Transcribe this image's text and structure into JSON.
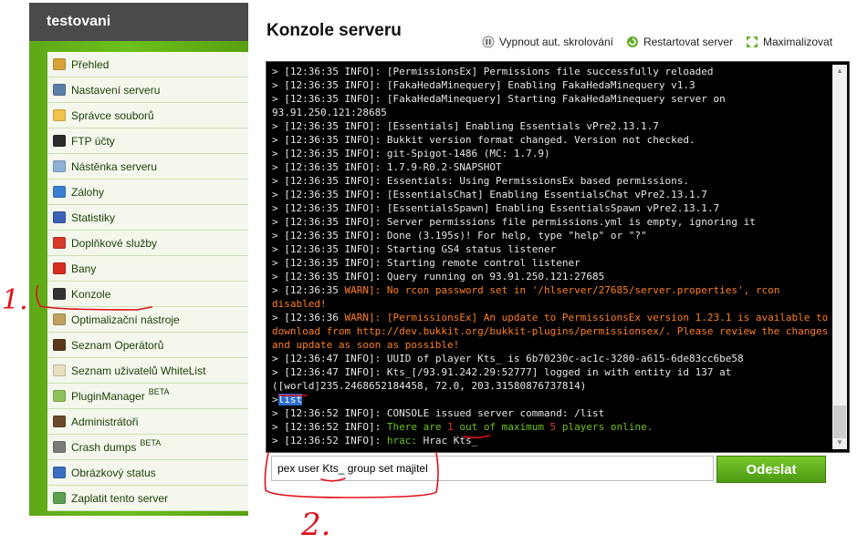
{
  "sidebar": {
    "brand": "testovani",
    "items": [
      {
        "label": "Přehled",
        "icon": "magnifier-icon",
        "color": "#d8a23a"
      },
      {
        "label": "Nastavení serveru",
        "icon": "wrench-icon",
        "color": "#5b7fa8"
      },
      {
        "label": "Správce souborů",
        "icon": "folder-icon",
        "color": "#f1c34a"
      },
      {
        "label": "FTP účty",
        "icon": "ftp-icon",
        "color": "#2a2a2a"
      },
      {
        "label": "Nástěnka serveru",
        "icon": "board-icon",
        "color": "#8fb0d6"
      },
      {
        "label": "Zálohy",
        "icon": "disc-icon",
        "color": "#3a7fd0"
      },
      {
        "label": "Statistiky",
        "icon": "chart-icon",
        "color": "#3c62b8"
      },
      {
        "label": "Doplňkové služby",
        "icon": "gift-icon",
        "color": "#d63b2a"
      },
      {
        "label": "Bany",
        "icon": "cross-icon",
        "color": "#d62d20"
      },
      {
        "label": "Konzole",
        "icon": "terminal-icon",
        "color": "#333333"
      },
      {
        "label": "Optimalizační nástroje",
        "icon": "wand-icon",
        "color": "#c0a060"
      },
      {
        "label": "Seznam Operátorů",
        "icon": "operator-icon",
        "color": "#5a3a1a"
      },
      {
        "label": "Seznam uživatelů WhiteList",
        "icon": "clipboard-icon",
        "color": "#e8e0c0"
      },
      {
        "label": "PluginManager",
        "icon": "puzzle-icon",
        "color": "#8fc25a",
        "badge": "BETA"
      },
      {
        "label": "Administrátoři",
        "icon": "admin-icon",
        "color": "#6b4a2a"
      },
      {
        "label": "Crash dumps",
        "icon": "gear-icon",
        "color": "#7a7a7a",
        "badge": "BETA"
      },
      {
        "label": "Obrázkový status",
        "icon": "image-icon",
        "color": "#3a6fc0"
      },
      {
        "label": "Zaplatit tento server",
        "icon": "money-icon",
        "color": "#5aa050"
      }
    ]
  },
  "main": {
    "title": "Konzole serveru",
    "toolbar": {
      "autoscroll": "Vypnout aut. skrolování",
      "restart": "Restartovat server",
      "maximize": "Maximalizovat"
    }
  },
  "console": {
    "lines": [
      {
        "type": "info",
        "prefix": "> [12:36:35 INFO]: ",
        "text": "[PermissionsEx] Permissions file successfully reloaded"
      },
      {
        "type": "info",
        "prefix": "> [12:36:35 INFO]: ",
        "text": "[FakaHedaMinequery] Enabling FakaHedaMinequery v1.3"
      },
      {
        "type": "info",
        "prefix": "> [12:36:35 INFO]: ",
        "text": "[FakaHedaMinequery] Starting FakaHedaMinequery server on 93.91.250.121:28685"
      },
      {
        "type": "info",
        "prefix": "> [12:36:35 INFO]: ",
        "text": "[Essentials] Enabling Essentials vPre2.13.1.7"
      },
      {
        "type": "info",
        "prefix": "> [12:36:35 INFO]: ",
        "text": "Bukkit version format changed. Version not checked."
      },
      {
        "type": "info",
        "prefix": "> [12:36:35 INFO]: ",
        "text": "git-Spigot-1486 (MC: 1.7.9)"
      },
      {
        "type": "info",
        "prefix": "> [12:36:35 INFO]: ",
        "text": "1.7.9-R0.2-SNAPSHOT"
      },
      {
        "type": "info",
        "prefix": "> [12:36:35 INFO]: ",
        "text": "Essentials: Using PermissionsEx based permissions."
      },
      {
        "type": "info",
        "prefix": "> [12:36:35 INFO]: ",
        "text": "[EssentialsChat] Enabling EssentialsChat vPre2.13.1.7"
      },
      {
        "type": "info",
        "prefix": "> [12:36:35 INFO]: ",
        "text": "[EssentialsSpawn] Enabling EssentialsSpawn vPre2.13.1.7"
      },
      {
        "type": "info",
        "prefix": "> [12:36:35 INFO]: ",
        "text": "Server permissions file permissions.yml is empty, ignoring it"
      },
      {
        "type": "info",
        "prefix": "> [12:36:35 INFO]: ",
        "text": "Done (3.195s)! For help, type \"help\" or \"?\""
      },
      {
        "type": "info",
        "prefix": "> [12:36:35 INFO]: ",
        "text": "Starting GS4 status listener"
      },
      {
        "type": "info",
        "prefix": "> [12:36:35 INFO]: ",
        "text": "Starting remote control listener"
      },
      {
        "type": "info",
        "prefix": "> [12:36:35 INFO]: ",
        "text": "Query running on 93.91.250.121:27685"
      },
      {
        "type": "warn",
        "prefix": "> [12:36:35 ",
        "tag": "WARN]: ",
        "text": "No rcon password set in '/hlserver/27685/server.properties', rcon disabled!"
      },
      {
        "type": "warn",
        "prefix": "> [12:36:36 ",
        "tag": "WARN]: ",
        "text": "[PermissionsEx] An update to PermissionsEx version 1.23.1 is available to download from http://dev.bukkit.org/bukkit-plugins/permissionsex/. Please review the changes and update as soon as possible!"
      },
      {
        "type": "info",
        "prefix": "> [12:36:47 INFO]: ",
        "text": "UUID of player Kts_ is 6b70230c-ac1c-3280-a615-6de83cc6be58"
      },
      {
        "type": "info",
        "prefix": "> [12:36:47 INFO]: ",
        "text": "Kts_[/93.91.242.29:52777] logged in with entity id 137 at ([world]235.2468652184458, 72.0, 203.31580876737814)"
      },
      {
        "type": "cmd",
        "prefix": ">",
        "text": "list"
      },
      {
        "type": "info",
        "prefix": "> [12:36:52 INFO]: ",
        "text": "CONSOLE issued server command: /list"
      },
      {
        "type": "players",
        "prefix": "> [12:36:52 INFO]: ",
        "t1": "There are ",
        "n1": "1",
        "t2": " out of maximum ",
        "n2": "5",
        "t3": " players online."
      },
      {
        "type": "hrac",
        "prefix": "> [12:36:52 INFO]: ",
        "t1": "hrac: ",
        "text": "Hrac Kts_"
      }
    ],
    "input_value": "pex user Kts_ group set majitel",
    "send_label": "Odeslat"
  },
  "annotations": {
    "mark1": "1.",
    "mark2": "2."
  },
  "colors": {
    "accent_green": "#6cbf1c",
    "warn": "#ff7f1c",
    "annotation": "#e0101a"
  }
}
